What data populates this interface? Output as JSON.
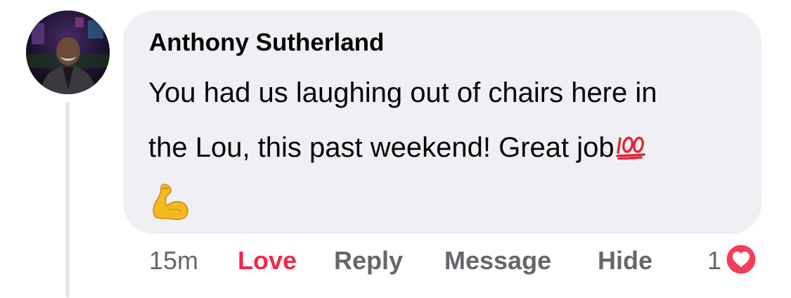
{
  "comment": {
    "author": "Anthony Sutherland",
    "avatar_alt": "avatar",
    "text_lines": [
      "You had us laughing out of chairs here in",
      "the Lou,  this past weekend! Great job"
    ],
    "emoji_inline": "hundred-points-emoji",
    "emoji_trailing": "flexed-biceps-emoji"
  },
  "actions": {
    "timestamp": "15m",
    "love_label": "Love",
    "reply_label": "Reply",
    "message_label": "Message",
    "hide_label": "Hide"
  },
  "reactions": {
    "count": "1",
    "icon": "love-heart-icon"
  },
  "colors": {
    "bubble_bg": "#f0f0f4",
    "love_active": "#f0284a",
    "action_gray": "#65676b",
    "heart_badge": "#f33e58"
  }
}
